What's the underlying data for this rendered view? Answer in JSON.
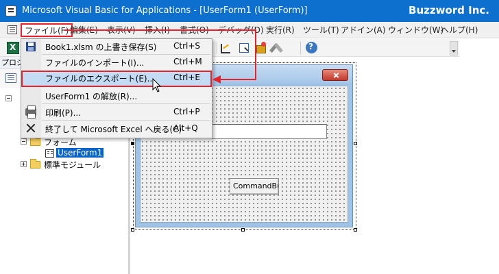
{
  "window": {
    "title": "Microsoft Visual Basic for Applications - [UserForm1 (UserForm)]",
    "brand": "Buzzword Inc."
  },
  "menubar": {
    "items": [
      {
        "label": "ファイル(F)"
      },
      {
        "label": "編集(E)"
      },
      {
        "label": "表示(V)"
      },
      {
        "label": "挿入(I)"
      },
      {
        "label": "書式(O)"
      },
      {
        "label": "デバッグ(D)"
      },
      {
        "label": "実行(R)"
      },
      {
        "label": "ツール(T)"
      },
      {
        "label": "アドイン(A)"
      },
      {
        "label": "ウィンドウ(W)"
      },
      {
        "label": "ヘルプ(H)"
      }
    ],
    "active_index": 0
  },
  "file_menu": {
    "items": [
      {
        "label": "Book1.xlsm の上書き保存(S)",
        "shortcut": "Ctrl+S",
        "icon": "save-icon"
      },
      {
        "label": "ファイルのインポート(I)...",
        "shortcut": "Ctrl+M",
        "icon": ""
      },
      {
        "label": "ファイルのエクスポート(E)...",
        "shortcut": "Ctrl+E",
        "icon": "",
        "highlighted": true
      },
      {
        "label": "UserForm1 の解放(R)...",
        "shortcut": "",
        "icon": ""
      },
      {
        "label": "印刷(P)...",
        "shortcut": "Ctrl+P",
        "icon": "print-icon"
      },
      {
        "label": "終了して Microsoft Excel へ戻る(C)",
        "shortcut": "Alt+Q",
        "icon": "exit-icon"
      }
    ]
  },
  "project_panel": {
    "title": "プロジ",
    "tree": {
      "forms_folder": "フォーム",
      "userform": "UserForm1",
      "modules_folder": "標準モジュール"
    }
  },
  "form_designer": {
    "command_button_caption": "CommandBu"
  },
  "colors": {
    "titlebar": "#0d6fce",
    "annotation": "#e8212b",
    "highlight": "#c4dcf3",
    "selection": "#0a64c8"
  }
}
